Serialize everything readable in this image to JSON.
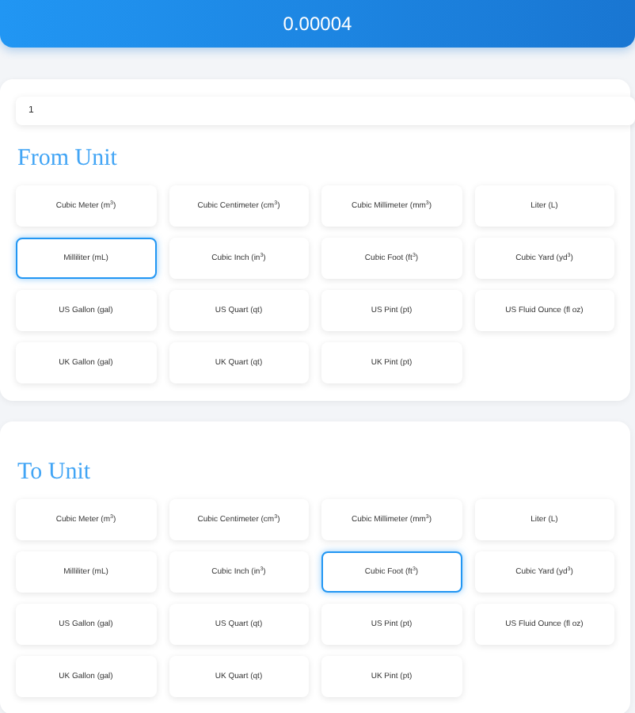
{
  "result": "0.00004",
  "input": {
    "value": "1"
  },
  "sections": [
    {
      "title": "From Unit",
      "options": [
        {
          "label": "Cubic Meter (m$^{3}$)",
          "selected": false
        },
        {
          "label": "Cubic Centimeter (cm$^{3}$)",
          "selected": false
        },
        {
          "label": "Cubic Millimeter (mm$^{3}$)",
          "selected": false
        },
        {
          "label": "Liter (L)",
          "selected": false
        },
        {
          "label": "Milliliter (mL)",
          "selected": true
        },
        {
          "label": "Cubic Inch (in$^{3}$)",
          "selected": false
        },
        {
          "label": "Cubic Foot (ft$^{3}$)",
          "selected": false
        },
        {
          "label": "Cubic Yard (yd$^{3}$)",
          "selected": false
        },
        {
          "label": "US Gallon (gal)",
          "selected": false
        },
        {
          "label": "US Quart (qt)",
          "selected": false
        },
        {
          "label": "US Pint (pt)",
          "selected": false
        },
        {
          "label": "US Fluid Ounce (fl oz)",
          "selected": false
        },
        {
          "label": "UK Gallon (gal)",
          "selected": false
        },
        {
          "label": "UK Quart (qt)",
          "selected": false
        },
        {
          "label": "UK Pint (pt)",
          "selected": false
        }
      ]
    },
    {
      "title": "To Unit",
      "options": [
        {
          "label": "Cubic Meter (m$^{3}$)",
          "selected": false
        },
        {
          "label": "Cubic Centimeter (cm$^{3}$)",
          "selected": false
        },
        {
          "label": "Cubic Millimeter (mm$^{3}$)",
          "selected": false
        },
        {
          "label": "Liter (L)",
          "selected": false
        },
        {
          "label": "Milliliter (mL)",
          "selected": false
        },
        {
          "label": "Cubic Inch (in$^{3}$)",
          "selected": false
        },
        {
          "label": "Cubic Foot (ft$^{3}$)",
          "selected": true
        },
        {
          "label": "Cubic Yard (yd$^{3}$)",
          "selected": false
        },
        {
          "label": "US Gallon (gal)",
          "selected": false
        },
        {
          "label": "US Quart (qt)",
          "selected": false
        },
        {
          "label": "US Pint (pt)",
          "selected": false
        },
        {
          "label": "US Fluid Ounce (fl oz)",
          "selected": false
        },
        {
          "label": "UK Gallon (gal)",
          "selected": false
        },
        {
          "label": "UK Quart (qt)",
          "selected": false
        },
        {
          "label": "UK Pint (pt)",
          "selected": false
        }
      ]
    }
  ]
}
